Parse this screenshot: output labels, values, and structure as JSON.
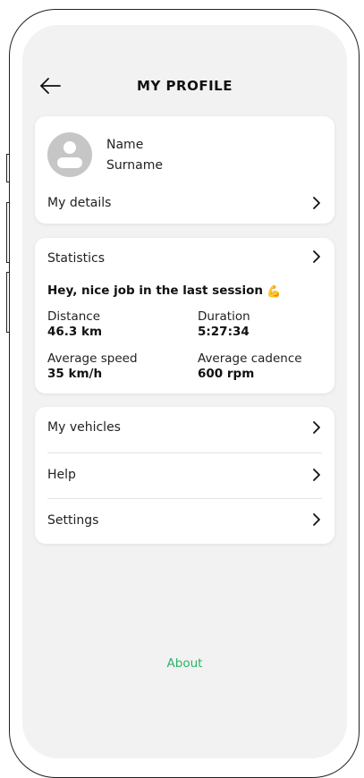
{
  "header": {
    "title": "MY PROFILE",
    "back_icon": "arrow-left-icon"
  },
  "profile": {
    "name": "Name",
    "surname": "Surname",
    "details_label": "My details"
  },
  "statistics": {
    "title": "Statistics",
    "headline": "Hey, nice job in the last session",
    "headline_emoji": "💪",
    "items": [
      {
        "label": "Distance",
        "value": "46.3 km"
      },
      {
        "label": "Duration",
        "value": "5:27:34"
      },
      {
        "label": "Average speed",
        "value": "35 km/h"
      },
      {
        "label": "Average cadence",
        "value": "600 rpm"
      }
    ]
  },
  "menu": {
    "items": [
      {
        "label": "My vehicles"
      },
      {
        "label": "Help"
      },
      {
        "label": "Settings"
      }
    ]
  },
  "footer": {
    "about_label": "About"
  },
  "colors": {
    "accent": "#2bb36a",
    "background": "#f2f2f2",
    "card": "#ffffff",
    "avatar": "#c6c6c6"
  }
}
